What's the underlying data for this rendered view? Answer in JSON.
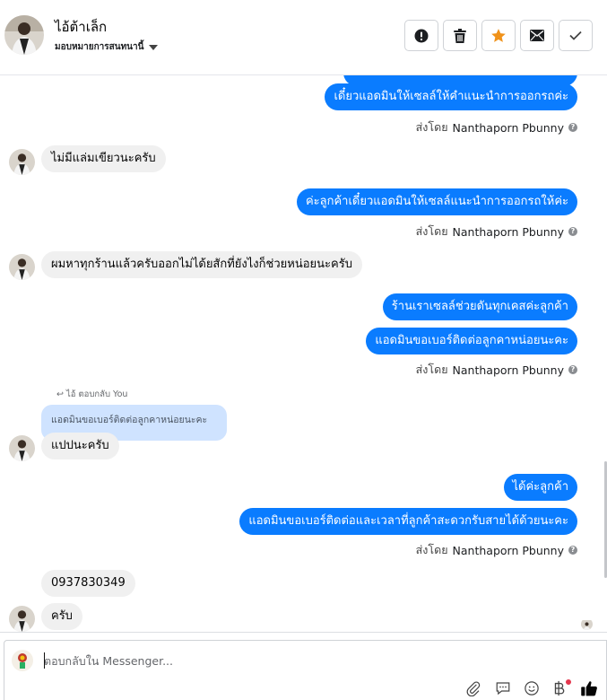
{
  "header": {
    "contact_name": "ไอ้ต้าเล็ก",
    "assign_label": "มอบหมายการสนทนานี้"
  },
  "toolbar": [
    {
      "name": "mark-spam-button",
      "icon": "alert-circle-icon"
    },
    {
      "name": "delete-button",
      "icon": "trash-icon"
    },
    {
      "name": "star-button",
      "icon": "star-icon",
      "color": "#f0921a"
    },
    {
      "name": "mark-unread-button",
      "icon": "envelope-icon"
    },
    {
      "name": "mark-done-button",
      "icon": "check-icon"
    }
  ],
  "sent_by": {
    "prefix": "ส่งโดย",
    "name": "Nanthaporn Pbunny"
  },
  "messages": {
    "m1": "เดี๋ยวแอดมินให้เซลล์ให้คำแนะนำการออกรถค่ะ",
    "m2": "ไม่มีแล่มเขียวนะครับ",
    "m3": "ค่ะลูกค้าเดี๋ยวแอดมินให้เซลล์แนะนำการออกรถให้ค่ะ",
    "m4": "ผมหาทุกร้านแล้วครับออกไม่ได้ยสักที่ยังไงก็ช่วยหน่อยนะครับ",
    "m5": "ร้านเราเซลล์ช่วยดันทุกเคสค่ะลูกค้า",
    "m6": "แอดมินขอเบอร์ติดต่อลูกคาหน่อยนะคะ",
    "reply_note": "ไอ้ ตอบกลับ You",
    "quoted": "แอดมินขอเบอร์ติดต่อลูกคาหน่อยนะคะ",
    "m7": "แปปนะครับ",
    "m8": "ได้ค่ะลูกค้า",
    "m9": "แอดมินขอเบอร์ติดต่อและเวลาที่ลูกค้าสะดวกรับสายได้ด้วยนะคะ",
    "m10": "0937830349",
    "m11": "ครับ"
  },
  "composer": {
    "placeholder": "ตอบกลับใน Messenger..."
  },
  "colors": {
    "outgoing_bubble": "#0a7cff",
    "incoming_bubble": "#f0f0f0",
    "quoted_bubble": "#cfe3ff",
    "like_icon": "#050505"
  }
}
